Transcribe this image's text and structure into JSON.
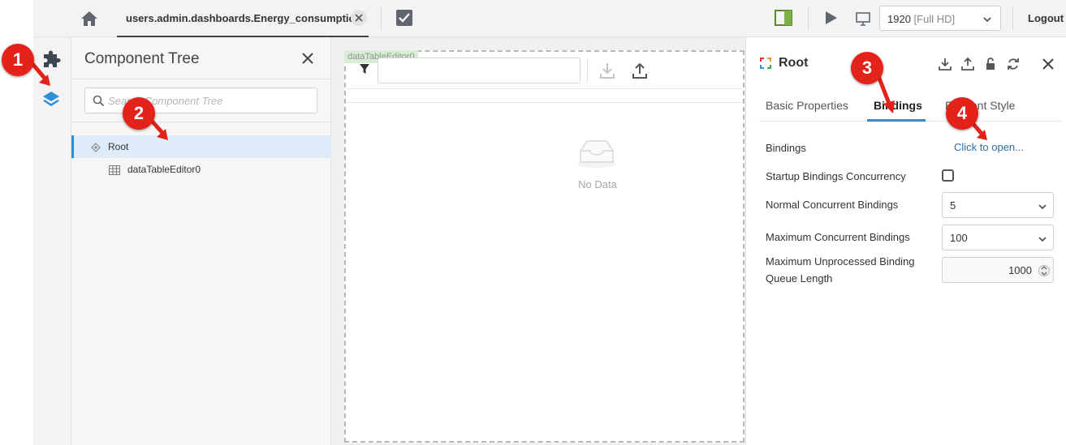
{
  "topbar": {
    "tab_title": "users.admin.dashboards.Energy_consumption",
    "resolution": {
      "value": "1920",
      "suffix": "[Full HD]"
    },
    "logout_label": "Logout"
  },
  "tree": {
    "title": "Component Tree",
    "search_placeholder": "Search Component Tree",
    "items": [
      {
        "label": "Root",
        "selected": true
      },
      {
        "label": "dataTableEditor0",
        "selected": false
      }
    ]
  },
  "canvas": {
    "component_tag": "dataTableEditor0",
    "empty_text": "No Data"
  },
  "properties": {
    "title": "Root",
    "tabs": [
      "Basic Properties",
      "Bindings",
      "Element Style"
    ],
    "active_tab": "Bindings",
    "rows": {
      "bindings_label": "Bindings",
      "bindings_link": "Click to open...",
      "startup_concurrency_label": "Startup Bindings Concurrency",
      "startup_concurrency_checked": false,
      "normal_concurrent_label": "Normal Concurrent Bindings",
      "normal_concurrent_value": "5",
      "max_concurrent_label": "Maximum Concurrent Bindings",
      "max_concurrent_value": "100",
      "max_queue_label_line1": "Maximum Unprocessed Binding",
      "max_queue_label_line2": "Queue Length",
      "max_queue_value": "1000"
    }
  },
  "markers": [
    "1",
    "2",
    "3",
    "4"
  ],
  "colors": {
    "accent": "#2d8fd5",
    "marker": "#e32219",
    "selection": "#ddecf8"
  }
}
